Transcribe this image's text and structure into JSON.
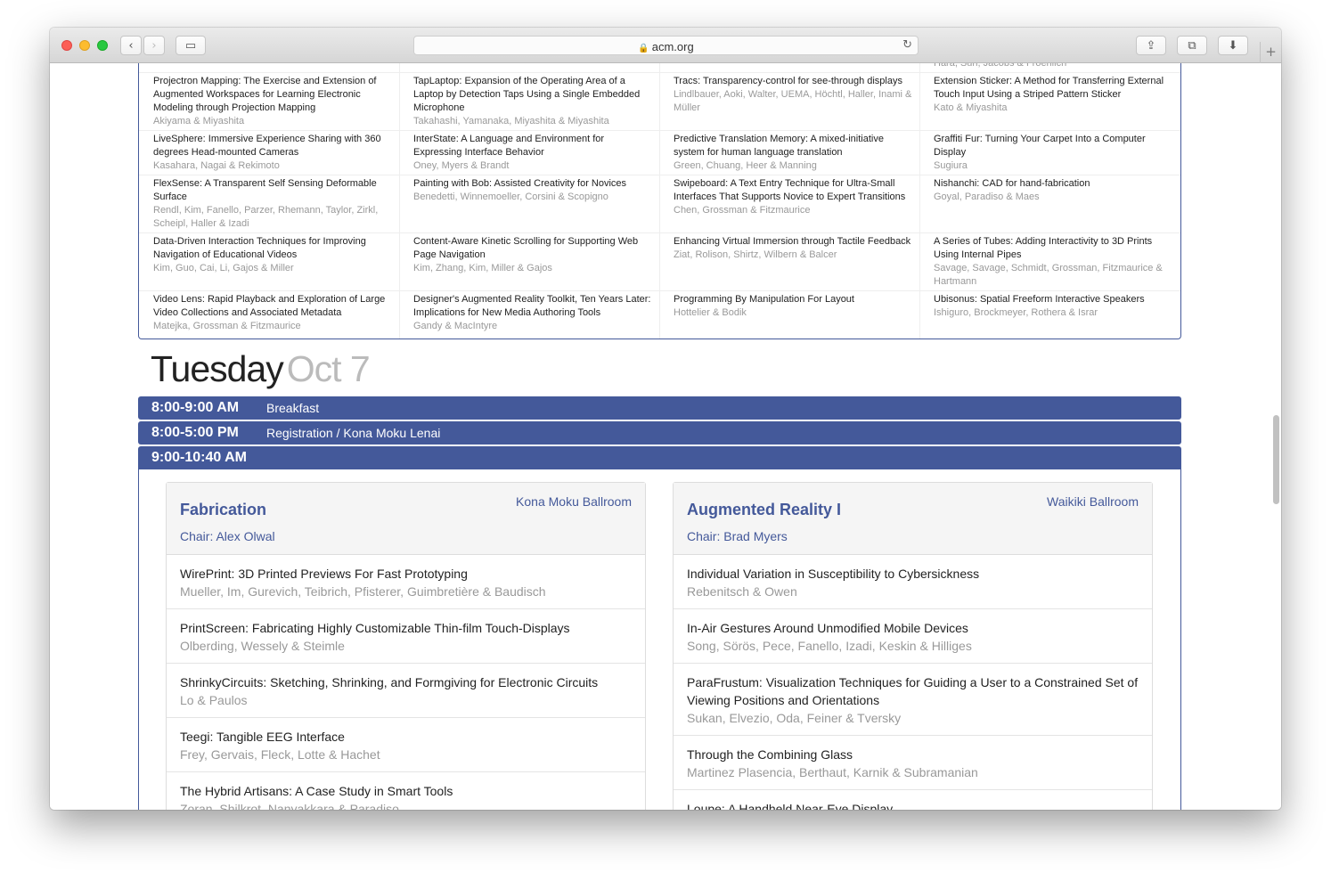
{
  "browser": {
    "url": "acm.org",
    "nav_back": "‹",
    "nav_forward": "›",
    "sidebar_icon": "▭",
    "share_icon": "⇪",
    "tabs_icon": "⧉",
    "downloads_icon": "⬇",
    "reload_icon": "↻",
    "lock_icon": "🔒",
    "new_tab_icon": "+"
  },
  "posters": {
    "columns": [
      [
        {
          "title": "",
          "authors": ""
        },
        {
          "title": "Projectron Mapping: The Exercise and Extension of Augmented Workspaces for Learning Electronic Modeling through Projection Mapping",
          "authors": "Akiyama & Miyashita"
        },
        {
          "title": "LiveSphere: Immersive Experience Sharing with 360 degrees Head-mounted Cameras",
          "authors": "Kasahara, Nagai & Rekimoto"
        },
        {
          "title": "FlexSense: A Transparent Self Sensing Deformable Surface",
          "authors": "Rendl, Kim, Fanello, Parzer, Rhemann, Taylor, Zirkl, Scheipl, Haller & Izadi"
        },
        {
          "title": "Data-Driven Interaction Techniques for Improving Navigation of Educational Videos",
          "authors": "Kim, Guo, Cai, Li, Gajos & Miller"
        },
        {
          "title": "Video Lens: Rapid Playback and Exploration of Large Video Collections and Associated Metadata",
          "authors": "Matejka, Grossman & Fitzmaurice"
        }
      ],
      [
        {
          "title": "",
          "authors": ""
        },
        {
          "title": "TapLaptop: Expansion of the Operating Area of a Laptop by Detection Taps Using a Single Embedded Microphone",
          "authors": "Takahashi, Yamanaka, Miyashita & Miyashita"
        },
        {
          "title": "InterState: A Language and Environment for Expressing Interface Behavior",
          "authors": "Oney, Myers & Brandt"
        },
        {
          "title": "Painting with Bob: Assisted Creativity for Novices",
          "authors": "Benedetti, Winnemoeller, Corsini & Scopigno"
        },
        {
          "title": "Content-Aware Kinetic Scrolling for Supporting Web Page Navigation",
          "authors": "Kim, Zhang, Kim, Miller & Gajos"
        },
        {
          "title": "Designer's Augmented Reality Toolkit, Ten Years Later: Implications for New Media Authoring Tools",
          "authors": "Gandy & MacIntyre"
        }
      ],
      [
        {
          "title": "",
          "authors": ""
        },
        {
          "title": "Tracs: Transparency-control for see-through displays",
          "authors": "Lindlbauer, Aoki, Walter, UEMA, Höchtl, Haller, Inami & Müller"
        },
        {
          "title": "Predictive Translation Memory: A mixed-initiative system for human language translation",
          "authors": "Green, Chuang, Heer & Manning"
        },
        {
          "title": "Swipeboard: A Text Entry Technique for Ultra-Small Interfaces That Supports Novice to Expert Transitions",
          "authors": "Chen, Grossman & Fitzmaurice"
        },
        {
          "title": "Enhancing Virtual Immersion through Tactile Feedback",
          "authors": "Ziat, Rolison, Shirtz, Wilbern & Balcer"
        },
        {
          "title": "Programming By Manipulation For Layout",
          "authors": "Hottelier & Bodik"
        }
      ],
      [
        {
          "title": "",
          "authors": "Hara, Sun, Jacobs & Froehlich"
        },
        {
          "title": "Extension Sticker: A Method for Transferring External Touch Input Using a Striped Pattern Sticker",
          "authors": "Kato & Miyashita"
        },
        {
          "title": "Graffiti Fur: Turning Your Carpet Into a Computer Display",
          "authors": "Sugiura"
        },
        {
          "title": "Nishanchi: CAD for hand-fabrication",
          "authors": "Goyal, Paradiso & Maes"
        },
        {
          "title": "A Series of Tubes: Adding Interactivity to 3D Prints Using Internal Pipes",
          "authors": "Savage, Savage, Schmidt, Grossman, Fitzmaurice & Hartmann"
        },
        {
          "title": "Ubisonus: Spatial Freeform Interactive Speakers",
          "authors": "Ishiguro, Brockmeyer, Rothera & Israr"
        }
      ]
    ]
  },
  "day": {
    "name": "Tuesday",
    "date": "Oct 7"
  },
  "timeslots": [
    {
      "time": "8:00-9:00 AM",
      "desc": "Breakfast"
    },
    {
      "time": "8:00-5:00 PM",
      "desc": "Registration / Kona Moku Lenai"
    },
    {
      "time": "9:00-10:40 AM",
      "desc": ""
    }
  ],
  "sessions": [
    {
      "name": "Fabrication",
      "room": "Kona Moku Ballroom",
      "chair": "Chair: Alex Olwal",
      "papers": [
        {
          "title": "WirePrint: 3D Printed Previews For Fast Prototyping",
          "authors": "Mueller, Im, Gurevich, Teibrich, Pfisterer, Guimbretière & Baudisch"
        },
        {
          "title": "PrintScreen: Fabricating Highly Customizable Thin-film Touch-Displays",
          "authors": "Olberding, Wessely & Steimle"
        },
        {
          "title": "ShrinkyCircuits: Sketching, Shrinking, and Formgiving for Electronic Circuits",
          "authors": "Lo & Paulos"
        },
        {
          "title": "Teegi: Tangible EEG Interface",
          "authors": "Frey, Gervais, Fleck, Lotte & Hachet"
        },
        {
          "title": "The Hybrid Artisans: A Case Study in Smart Tools",
          "authors": "Zoran, Shilkrot, Nanyakkara & Paradiso"
        }
      ]
    },
    {
      "name": "Augmented Reality I",
      "room": "Waikiki Ballroom",
      "chair": "Chair: Brad Myers",
      "papers": [
        {
          "title": "Individual Variation in Susceptibility to Cybersickness",
          "authors": "Rebenitsch & Owen"
        },
        {
          "title": "In-Air Gestures Around Unmodified Mobile Devices",
          "authors": "Song, Sörös, Pece, Fanello, Izadi, Keskin & Hilliges"
        },
        {
          "title": "ParaFrustum: Visualization Techniques for Guiding a User to a Constrained Set of Viewing Positions and Orientations",
          "authors": "Sukan, Elvezio, Oda, Feiner & Tversky"
        },
        {
          "title": "Through the Combining Glass",
          "authors": "Martinez Plasencia, Berthaut, Karnik & Subramanian"
        },
        {
          "title": "Loupe: A Handheld Near-Eye Display",
          "authors": ""
        }
      ]
    }
  ]
}
